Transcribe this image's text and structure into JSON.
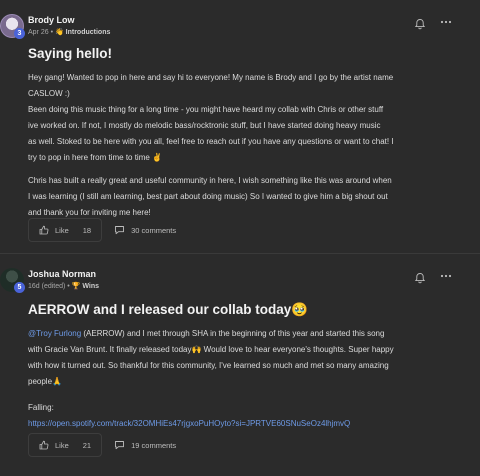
{
  "posts": [
    {
      "author": "Brody Low",
      "level": "3",
      "date": "Apr 26",
      "category_emoji": "👋",
      "category": "Introductions",
      "title": "Saying hello!",
      "paragraph1_lines": [
        "Hey gang! Wanted to pop in here and say hi to everyone! My name is Brody and I go by the artist name",
        "CASLOW :)",
        "Been doing this music thing for a long time - you might have heard my collab with Chris or other stuff",
        "ive worked on. If not, I mostly do melodic bass/rocktronic stuff, but I have started doing heavy music",
        "as well. Stoked to be here with you all, feel free to reach out if you have any questions or want to chat! I",
        "try to pop in here from time to time ✌️"
      ],
      "paragraph2_lines": [
        "Chris has built a really great and useful community in here, I wish something like this was around when",
        "I was learning (I still am learning, best part about doing music) So I wanted to give him a big shout out",
        "and thank you for inviting me here!"
      ],
      "like_label": "Like",
      "like_count": "18",
      "comments_label": "30 comments"
    },
    {
      "author": "Joshua Norman",
      "level": "5",
      "date": "16d (edited)",
      "category_emoji": "🏆",
      "category": "Wins",
      "title": "AERROW and I released our collab today🥹",
      "mention": "@Troy Furlong",
      "line1_rest": " (AERROW) and I met through SHA in the beginning of this year and started this song",
      "lines": [
        "with Gracie Van Brunt. It finally released today🙌 Would love to hear everyone's thoughts. Super happy",
        "with how it turned out. So thankful for this community, I've learned so much and met so many amazing",
        "people🙏"
      ],
      "falling_label": "Falling:",
      "link": "https://open.spotify.com/track/32OMHiEs47rjgxoPuHOyto?si=JPRTVE60SNuSeOz4lhjmvQ",
      "like_label": "Like",
      "like_count": "21",
      "comments_label": "19 comments"
    }
  ]
}
